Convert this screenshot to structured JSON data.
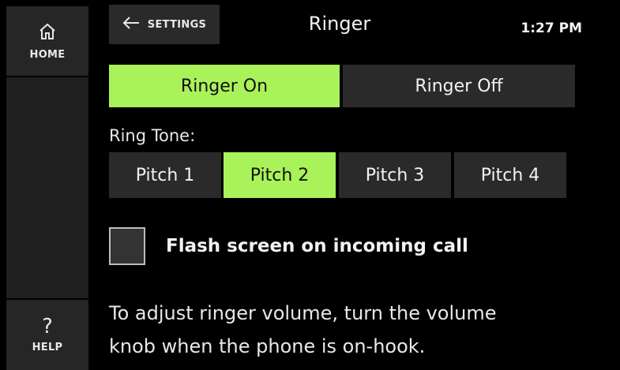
{
  "sidebar": {
    "home_label": "HOME",
    "help_label": "HELP",
    "help_glyph": "?"
  },
  "header": {
    "back_label": "SETTINGS",
    "title": "Ringer",
    "time": "1:27 PM"
  },
  "ringer": {
    "on_label": "Ringer On",
    "off_label": "Ringer Off",
    "selected": "Ringer On"
  },
  "ring_tone": {
    "label": "Ring Tone:",
    "options": [
      "Pitch 1",
      "Pitch 2",
      "Pitch 3",
      "Pitch 4"
    ],
    "selected": "Pitch 2"
  },
  "flash": {
    "label": "Flash screen on incoming call",
    "checked": false
  },
  "info_text": {
    "line1": "To adjust ringer volume, turn the volume",
    "line2": "knob when the phone is on-hook."
  },
  "colors": {
    "accent": "#a9f25a",
    "button": "#2a2a2a",
    "background": "#000000"
  },
  "icons": {
    "home": "home-icon",
    "back": "arrow-left-icon",
    "help": "question-mark-icon"
  }
}
